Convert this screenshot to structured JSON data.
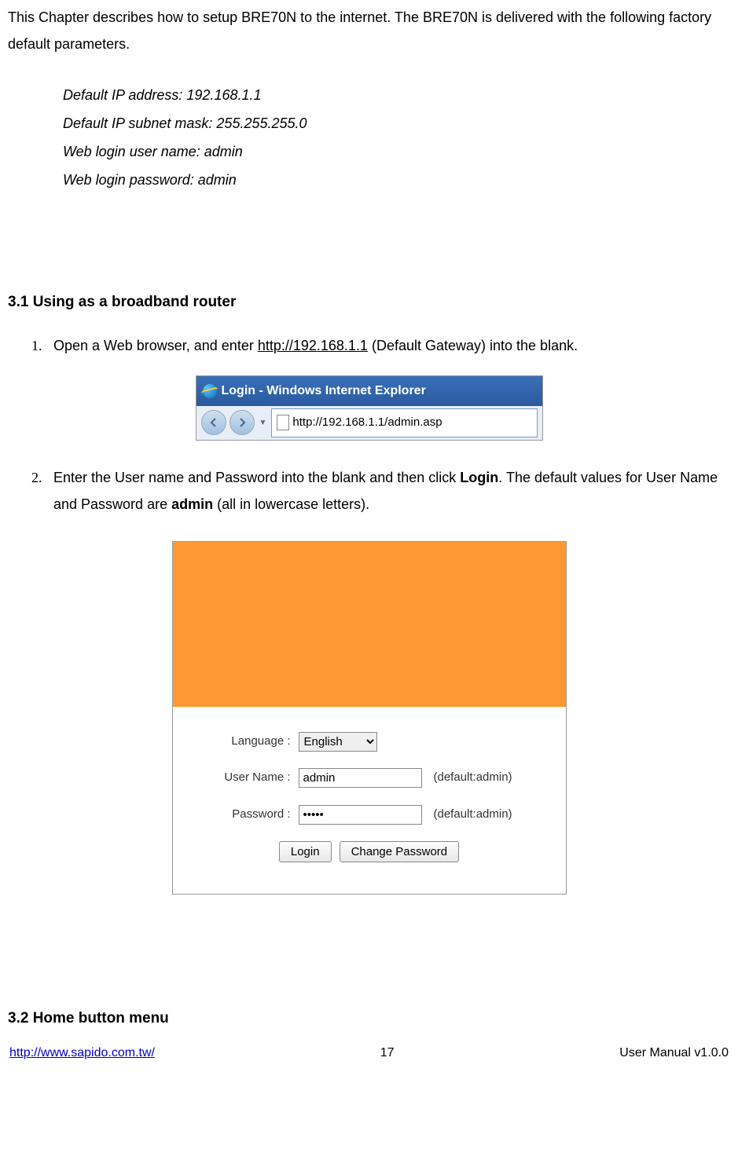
{
  "intro": "This Chapter describes how to setup BRE70N to the internet. The BRE70N is delivered with the following factory default parameters.",
  "defaults": {
    "ip": "Default IP address: 192.168.1.1",
    "mask": "Default IP subnet mask: 255.255.255.0",
    "user": "Web login user name: admin",
    "pass": "Web login password: admin"
  },
  "section_3_1": {
    "heading": "3.1    Using as a broadband router",
    "step1_num": "1.",
    "step1_pre": "Open a Web browser, and enter ",
    "step1_link": "http://192.168.1.1",
    "step1_post": " (Default Gateway) into the blank.",
    "step2_num": "2.",
    "step2_pre": "Enter the User name and Password into the blank and then click ",
    "step2_bold": "Login",
    "step2_mid": ".    The default values for User Name and Password are ",
    "step2_bold2": "admin",
    "step2_post": " (all in lowercase letters)."
  },
  "browser": {
    "title": "Login - Windows Internet Explorer",
    "url": "http://192.168.1.1/admin.asp"
  },
  "login_form": {
    "language_label": "Language :",
    "language_value": "English",
    "username_label": "User Name :",
    "username_value": "admin",
    "username_hint": "(default:admin)",
    "password_label": "Password :",
    "password_value": "•••••",
    "password_hint": "(default:admin)",
    "login_btn": "Login",
    "change_pw_btn": "Change Password"
  },
  "section_3_2": {
    "heading": "3.2    Home button menu"
  },
  "footer": {
    "url": "http://www.sapido.com.tw/",
    "page": "17",
    "version": "User  Manual  v1.0.0"
  }
}
